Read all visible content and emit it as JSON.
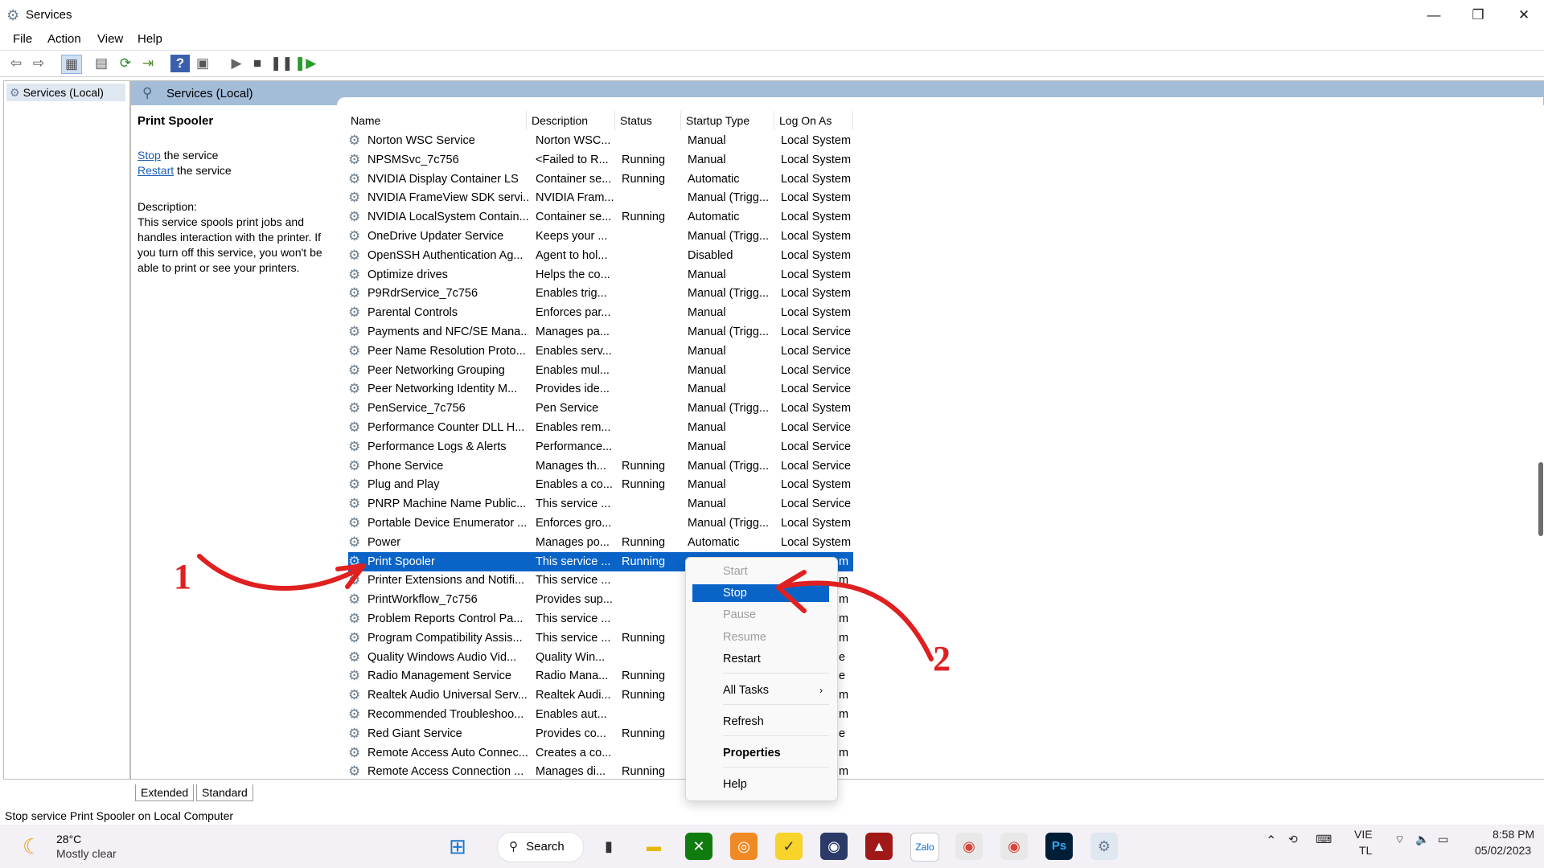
{
  "window": {
    "title": "Services",
    "controls": {
      "minimize": "—",
      "restore": "❐",
      "close": "✕"
    }
  },
  "menu": [
    "File",
    "Action",
    "View",
    "Help"
  ],
  "toolbar_icons": [
    "back-icon",
    "forward-icon",
    "console-tree-icon",
    "properties-icon",
    "refresh-icon",
    "export-icon",
    "help-icon",
    "view-icon",
    "start-icon",
    "stop-icon",
    "pause-icon",
    "resume-icon"
  ],
  "tree": {
    "node": "Services (Local)"
  },
  "pane_header": "Services (Local)",
  "detail": {
    "name": "Print Spooler",
    "stop_link": "Stop",
    "stop_suffix": " the service",
    "restart_link": "Restart",
    "restart_suffix": " the service",
    "desc_label": "Description:",
    "desc_text": "This service spools print jobs and handles interaction with the printer. If you turn off this service, you won't be able to print or see your printers."
  },
  "columns": [
    "Name",
    "Description",
    "Status",
    "Startup Type",
    "Log On As"
  ],
  "rows": [
    [
      "Norton WSC Service",
      "Norton WSC...",
      "",
      "Manual",
      "Local System"
    ],
    [
      "NPSMSvc_7c756",
      "<Failed to R...",
      "Running",
      "Manual",
      "Local System"
    ],
    [
      "NVIDIA Display Container LS",
      "Container se...",
      "Running",
      "Automatic",
      "Local System"
    ],
    [
      "NVIDIA FrameView SDK servi...",
      "NVIDIA Fram...",
      "",
      "Manual (Trigg...",
      "Local System"
    ],
    [
      "NVIDIA LocalSystem Contain...",
      "Container se...",
      "Running",
      "Automatic",
      "Local System"
    ],
    [
      "OneDrive Updater Service",
      "Keeps your ...",
      "",
      "Manual (Trigg...",
      "Local System"
    ],
    [
      "OpenSSH Authentication Ag...",
      "Agent to hol...",
      "",
      "Disabled",
      "Local System"
    ],
    [
      "Optimize drives",
      "Helps the co...",
      "",
      "Manual",
      "Local System"
    ],
    [
      "P9RdrService_7c756",
      "Enables trig...",
      "",
      "Manual (Trigg...",
      "Local System"
    ],
    [
      "Parental Controls",
      "Enforces par...",
      "",
      "Manual",
      "Local System"
    ],
    [
      "Payments and NFC/SE Mana...",
      "Manages pa...",
      "",
      "Manual (Trigg...",
      "Local Service"
    ],
    [
      "Peer Name Resolution Proto...",
      "Enables serv...",
      "",
      "Manual",
      "Local Service"
    ],
    [
      "Peer Networking Grouping",
      "Enables mul...",
      "",
      "Manual",
      "Local Service"
    ],
    [
      "Peer Networking Identity M...",
      "Provides ide...",
      "",
      "Manual",
      "Local Service"
    ],
    [
      "PenService_7c756",
      "Pen Service",
      "",
      "Manual (Trigg...",
      "Local System"
    ],
    [
      "Performance Counter DLL H...",
      "Enables rem...",
      "",
      "Manual",
      "Local Service"
    ],
    [
      "Performance Logs & Alerts",
      "Performance...",
      "",
      "Manual",
      "Local Service"
    ],
    [
      "Phone Service",
      "Manages th...",
      "Running",
      "Manual (Trigg...",
      "Local Service"
    ],
    [
      "Plug and Play",
      "Enables a co...",
      "Running",
      "Manual",
      "Local System"
    ],
    [
      "PNRP Machine Name Public...",
      "This service ...",
      "",
      "Manual",
      "Local Service"
    ],
    [
      "Portable Device Enumerator ...",
      "Enforces gro...",
      "",
      "Manual (Trigg...",
      "Local System"
    ],
    [
      "Power",
      "Manages po...",
      "Running",
      "Automatic",
      "Local System"
    ],
    [
      "Print Spooler",
      "This service ...",
      "Running",
      "",
      "m"
    ],
    [
      "Printer Extensions and Notifi...",
      "This service ...",
      "",
      "",
      "m"
    ],
    [
      "PrintWorkflow_7c756",
      "Provides sup...",
      "",
      "",
      "m"
    ],
    [
      "Problem Reports Control Pa...",
      "This service ...",
      "",
      "",
      "m"
    ],
    [
      "Program Compatibility Assis...",
      "This service ...",
      "Running",
      "",
      "m"
    ],
    [
      "Quality Windows Audio Vid...",
      "Quality Win...",
      "",
      "",
      "e"
    ],
    [
      "Radio Management Service",
      "Radio Mana...",
      "Running",
      "",
      "e"
    ],
    [
      "Realtek Audio Universal Serv...",
      "Realtek Audi...",
      "Running",
      "",
      "m"
    ],
    [
      "Recommended Troubleshoo...",
      "Enables aut...",
      "",
      "",
      "m"
    ],
    [
      "Red Giant Service",
      "Provides co...",
      "Running",
      "",
      "e"
    ],
    [
      "Remote Access Auto Connec...",
      "Creates a co...",
      "",
      "",
      "m"
    ],
    [
      "Remote Access Connection ...",
      "Manages di...",
      "Running",
      "",
      "m"
    ]
  ],
  "selected_row": 22,
  "context_menu": {
    "start": "Start",
    "stop": "Stop",
    "pause": "Pause",
    "resume": "Resume",
    "restart": "Restart",
    "all_tasks": "All Tasks",
    "refresh": "Refresh",
    "properties": "Properties",
    "help": "Help"
  },
  "bottom_tabs": [
    "Extended",
    "Standard"
  ],
  "status_text": "Stop service Print Spooler on Local Computer",
  "annotations": {
    "one": "1",
    "two": "2"
  },
  "taskbar": {
    "weather_temp": "28°C",
    "weather_desc": "Mostly clear",
    "search_label": "Search",
    "lang": "VIE",
    "layout": "TL",
    "time": "8:58 PM",
    "date": "05/02/2023"
  },
  "colors": {
    "selection": "#0a64c8",
    "header": "#a3bcd8",
    "annotation": "#e02020"
  }
}
